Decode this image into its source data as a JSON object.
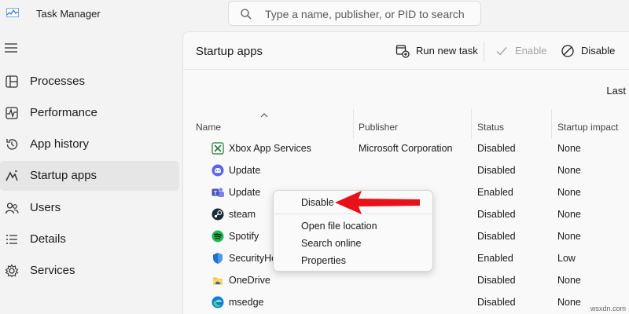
{
  "app": {
    "title": "Task Manager"
  },
  "search": {
    "placeholder": "Type a name, publisher, or PID to search"
  },
  "nav": {
    "items": [
      {
        "label": "Processes",
        "icon": "processes-icon"
      },
      {
        "label": "Performance",
        "icon": "performance-icon"
      },
      {
        "label": "App history",
        "icon": "history-icon"
      },
      {
        "label": "Startup apps",
        "icon": "startup-icon",
        "active": true
      },
      {
        "label": "Users",
        "icon": "users-icon"
      },
      {
        "label": "Details",
        "icon": "details-icon"
      },
      {
        "label": "Services",
        "icon": "services-icon"
      }
    ]
  },
  "toolbar": {
    "title": "Startup apps",
    "run_new_task": "Run new task",
    "enable": "Enable",
    "disable": "Disable"
  },
  "last_label": "Last",
  "table": {
    "columns": [
      "Name",
      "Publisher",
      "Status",
      "Startup impact"
    ],
    "rows": [
      {
        "name": "Xbox App Services",
        "publisher": "Microsoft Corporation",
        "status": "Disabled",
        "impact": "None",
        "icon": "xbox-icon"
      },
      {
        "name": "Update",
        "publisher": "",
        "status": "Disabled",
        "impact": "None",
        "icon": "discord-icon"
      },
      {
        "name": "Update",
        "publisher": "",
        "status": "Enabled",
        "impact": "None",
        "icon": "teams-icon"
      },
      {
        "name": "steam",
        "publisher": "",
        "status": "Disabled",
        "impact": "None",
        "icon": "steam-icon"
      },
      {
        "name": "Spotify",
        "publisher": "",
        "status": "Disabled",
        "impact": "None",
        "icon": "spotify-icon"
      },
      {
        "name": "SecurityHe",
        "publisher": "",
        "status": "Enabled",
        "impact": "Low",
        "icon": "security-shield-icon"
      },
      {
        "name": "OneDrive",
        "publisher": "",
        "status": "Disabled",
        "impact": "None",
        "icon": "onedrive-icon"
      },
      {
        "name": "msedge",
        "publisher": "",
        "status": "Disabled",
        "impact": "None",
        "icon": "edge-icon"
      }
    ]
  },
  "context_menu": {
    "items": [
      "Disable",
      "Open file location",
      "Search online",
      "Properties"
    ]
  },
  "watermark": "wsxdn.com",
  "colors": {
    "accent_arrow": "#e8111a",
    "active_nav": "#e6e6e6"
  }
}
